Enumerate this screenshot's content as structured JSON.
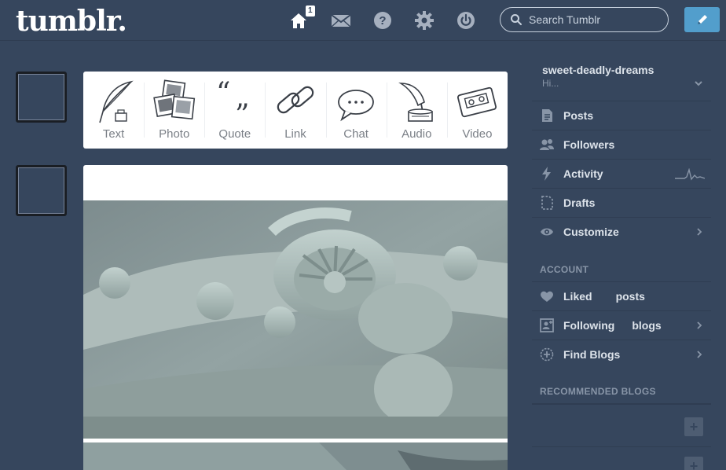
{
  "header": {
    "logo": "tumblr.",
    "home_badge": "1",
    "search_placeholder": "Search Tumblr",
    "nav_icons": [
      "home-icon",
      "mail-icon",
      "help-icon",
      "gear-icon",
      "power-icon"
    ]
  },
  "post_types": [
    {
      "label": "Text",
      "icon": "quill-icon"
    },
    {
      "label": "Photo",
      "icon": "photos-icon"
    },
    {
      "label": "Quote",
      "icon": "quote-icon"
    },
    {
      "label": "Link",
      "icon": "chain-link-icon"
    },
    {
      "label": "Chat",
      "icon": "chat-bubble-icon"
    },
    {
      "label": "Audio",
      "icon": "gramophone-icon"
    },
    {
      "label": "Video",
      "icon": "cassette-icon"
    }
  ],
  "sidebar": {
    "blog_name": "sweet-deadly-dreams",
    "blog_subtitle": "Hi...",
    "items": [
      {
        "label": "Posts",
        "extra": "",
        "icon": "document-icon"
      },
      {
        "label": "Followers",
        "extra": "",
        "icon": "people-icon"
      },
      {
        "label": "Activity",
        "extra": "",
        "icon": "lightning-icon"
      },
      {
        "label": "Drafts",
        "extra": "",
        "icon": "drafts-icon"
      },
      {
        "label": "Customize",
        "extra": "",
        "icon": "eye-icon"
      }
    ],
    "account_heading": "ACCOUNT",
    "account_items": [
      {
        "label": "Liked",
        "extra": "posts",
        "icon": "heart-icon"
      },
      {
        "label": "Following",
        "extra": "blogs",
        "icon": "following-icon"
      },
      {
        "label": "Find Blogs",
        "extra": "",
        "icon": "compass-icon"
      }
    ],
    "recommended_heading": "RECOMMENDED BLOGS"
  },
  "colors": {
    "background": "#36465d",
    "compose_button": "#529ecc",
    "card": "#ffffff",
    "muted_text": "#8895a7"
  }
}
